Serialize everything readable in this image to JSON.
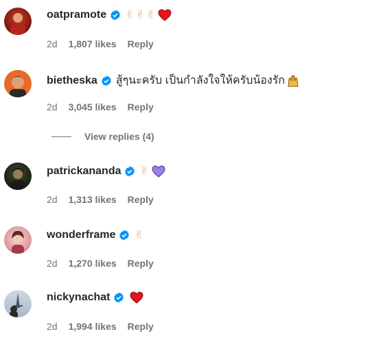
{
  "comments": [
    {
      "username": "oatpramote",
      "text": "",
      "emojis": [
        "✌",
        "✌",
        "✌"
      ],
      "heart_color": "#ed1c24",
      "time": "2d",
      "likes": "1,807 likes",
      "reply": "Reply"
    },
    {
      "username": "bietheska",
      "text": "สู้ๆนะครับ เป็นกำลังใจให้ครับน้องรัก",
      "emojis": [],
      "time": "2d",
      "likes": "3,045 likes",
      "reply": "Reply",
      "view_replies": "View replies (4)"
    },
    {
      "username": "patrickananda",
      "text": "",
      "emojis": [
        "✌"
      ],
      "heart_color": "#9b7ee6",
      "time": "2d",
      "likes": "1,313 likes",
      "reply": "Reply"
    },
    {
      "username": "wonderframe",
      "text": "",
      "emojis": [
        "✌"
      ],
      "time": "2d",
      "likes": "1,270 likes",
      "reply": "Reply"
    },
    {
      "username": "nickynachat",
      "text": "",
      "emojis": [],
      "heart_color": "#ed1c24",
      "time": "2d",
      "likes": "1,994 likes",
      "reply": "Reply"
    }
  ],
  "colors": {
    "verified": "#0095f6",
    "meta": "#737373",
    "username": "#262626"
  }
}
